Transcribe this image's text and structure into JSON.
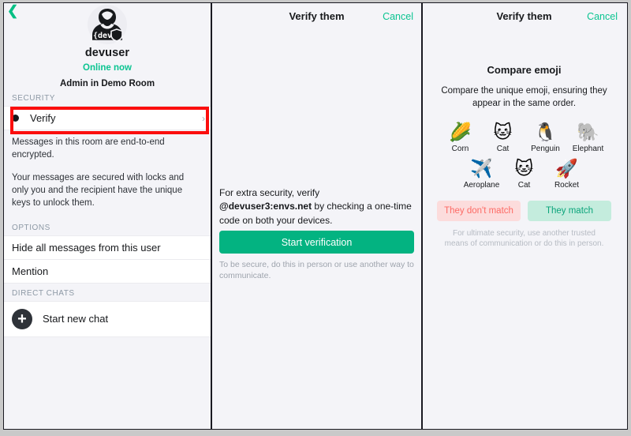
{
  "colors": {
    "accent_green": "#03B381",
    "presence_green": "#0BC491",
    "annotation_red": "#FB0E0E",
    "danger_pink_bg": "#FCDCDC",
    "danger_text": "#FD6A64",
    "success_mint_bg": "#C4ECDD",
    "success_text": "#0AA47A",
    "page_bg": "#F4F4F8"
  },
  "left_panel": {
    "back_icon": "back-chevron-icon",
    "avatar_badge_text": "{dev}",
    "user_name": "devuser",
    "presence": "Online now",
    "role": "Admin in Demo Room",
    "security_header": "SECURITY",
    "verify_label": "Verify",
    "row_chevron": "›",
    "encryption_note_1": "Messages in this room are end-to-end encrypted.",
    "encryption_note_2": "Your messages are secured with locks and only you and the recipient have the unique keys to unlock them.",
    "options_header": "OPTIONS",
    "option_hide": "Hide all messages from this user",
    "option_mention": "Mention",
    "direct_chats_header": "DIRECT CHATS",
    "start_new_chat": "Start new chat",
    "plus_icon": "+"
  },
  "middle_panel": {
    "title": "Verify them",
    "cancel": "Cancel",
    "lead_prefix": "For extra security, verify ",
    "lead_user_id": "@devuser3:envs.net",
    "lead_suffix": " by checking a one-time code on both your devices.",
    "start_button": "Start verification",
    "footer": "To be secure, do this in person or use another way to communicate."
  },
  "right_panel": {
    "title": "Verify them",
    "cancel": "Cancel",
    "heading": "Compare emoji",
    "subheading": "Compare the unique emoji, ensuring they appear in the same order.",
    "emoji": [
      {
        "glyph": "🌽",
        "label": "Corn"
      },
      {
        "glyph": "🐱",
        "label": "Cat"
      },
      {
        "glyph": "🐧",
        "label": "Penguin"
      },
      {
        "glyph": "🐘",
        "label": "Elephant"
      },
      {
        "glyph": "✈️",
        "label": "Aeroplane"
      },
      {
        "glyph": "🐱",
        "label": "Cat"
      },
      {
        "glyph": "🚀",
        "label": "Rocket"
      }
    ],
    "button_no_match": "They don't match",
    "button_match": "They match",
    "footer": "For ultimate security, use another trusted means of communication or do this in person."
  }
}
